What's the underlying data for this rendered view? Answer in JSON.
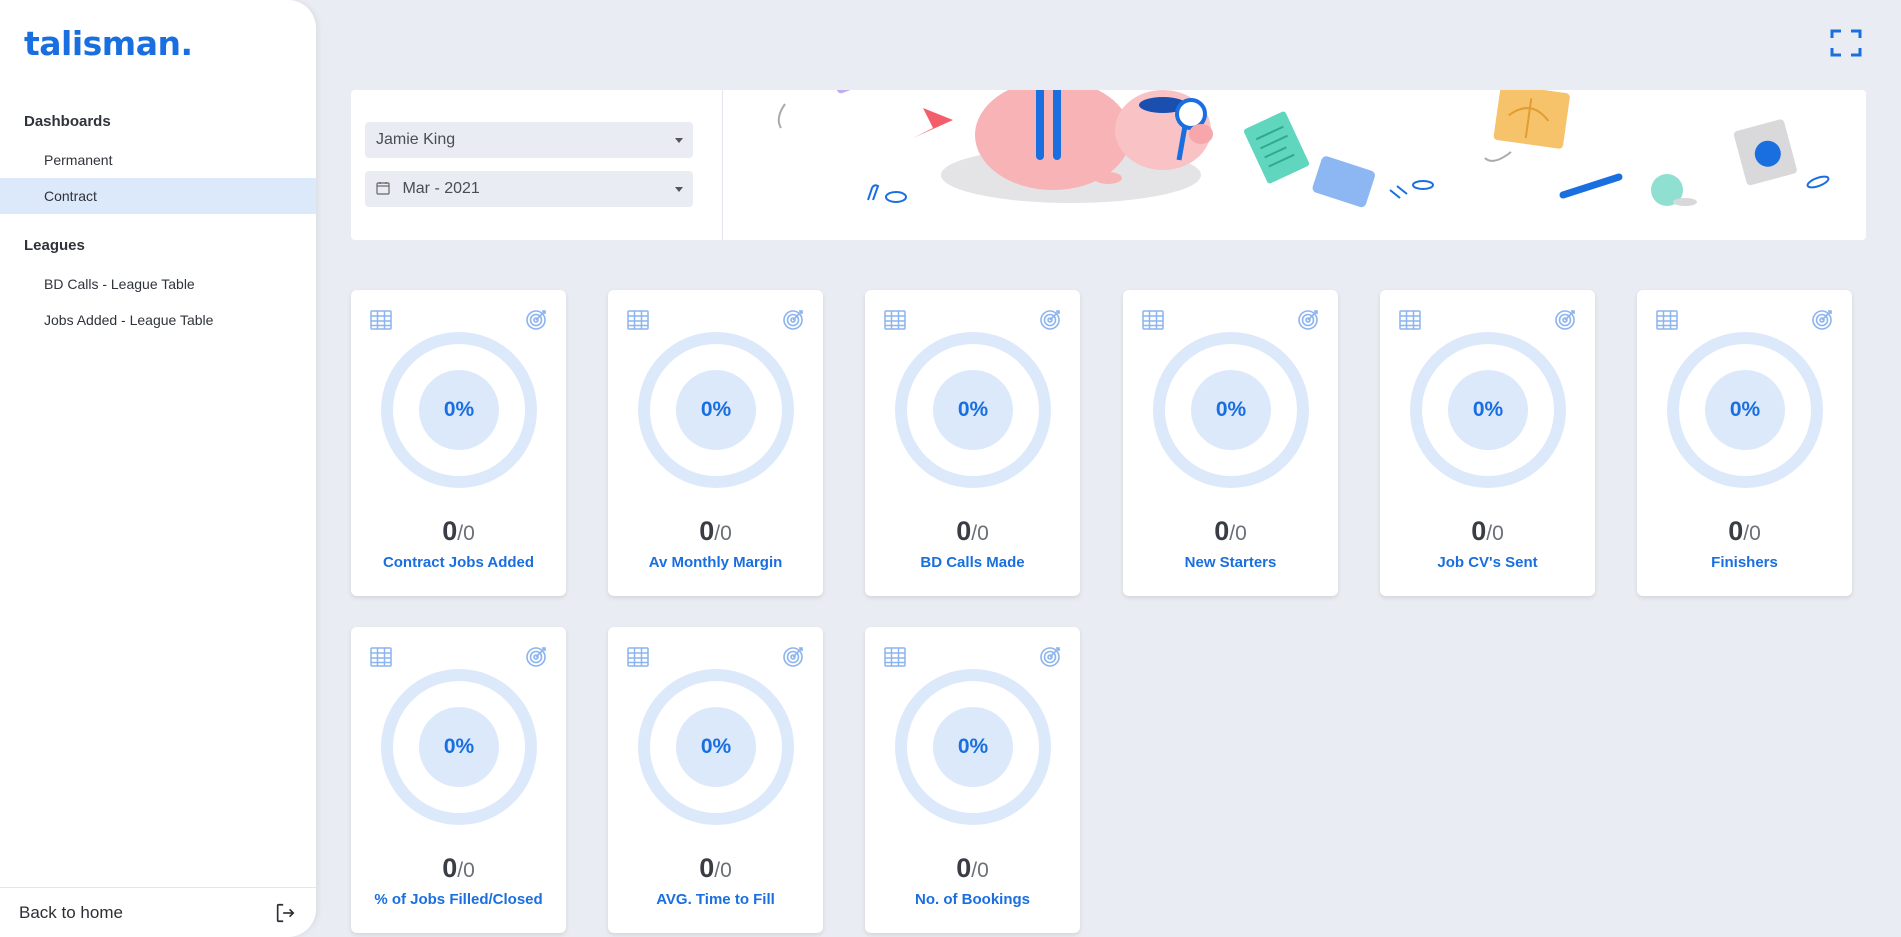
{
  "sidebar": {
    "logo": "talisman.",
    "sections": [
      {
        "title": "Dashboards",
        "items": [
          {
            "label": "Permanent"
          },
          {
            "label": "Contract"
          }
        ]
      },
      {
        "title": "Leagues",
        "items": [
          {
            "label": "BD Calls - League Table"
          },
          {
            "label": "Jobs Added - League Table"
          }
        ]
      }
    ],
    "active_item": "Contract",
    "back_home": "Back to home"
  },
  "filters": {
    "user": "Jamie King",
    "period": "Mar - 2021"
  },
  "cards": [
    {
      "percent": "0%",
      "value": "0",
      "target": "0",
      "label": "Contract Jobs Added"
    },
    {
      "percent": "0%",
      "value": "0",
      "target": "0",
      "label": "Av Monthly Margin"
    },
    {
      "percent": "0%",
      "value": "0",
      "target": "0",
      "label": "BD Calls Made"
    },
    {
      "percent": "0%",
      "value": "0",
      "target": "0",
      "label": "New Starters"
    },
    {
      "percent": "0%",
      "value": "0",
      "target": "0",
      "label": "Job CV's Sent"
    },
    {
      "percent": "0%",
      "value": "0",
      "target": "0",
      "label": "Finishers"
    },
    {
      "percent": "0%",
      "value": "0",
      "target": "0",
      "label": "% of Jobs Filled/Closed"
    },
    {
      "percent": "0%",
      "value": "0",
      "target": "0",
      "label": "AVG. Time to Fill"
    },
    {
      "percent": "0%",
      "value": "0",
      "target": "0",
      "label": "No. of Bookings"
    }
  ],
  "separator": "/",
  "colors": {
    "accent": "#1a6fe0",
    "ring": "#dce9fb",
    "background": "#e9ecf2",
    "active_nav": "#dce9fb"
  },
  "icons": {
    "card_left": "table-grid-icon",
    "card_right": "target-icon",
    "fullscreen": "fullscreen-icon",
    "logout": "logout-icon",
    "calendar": "calendar-icon"
  }
}
